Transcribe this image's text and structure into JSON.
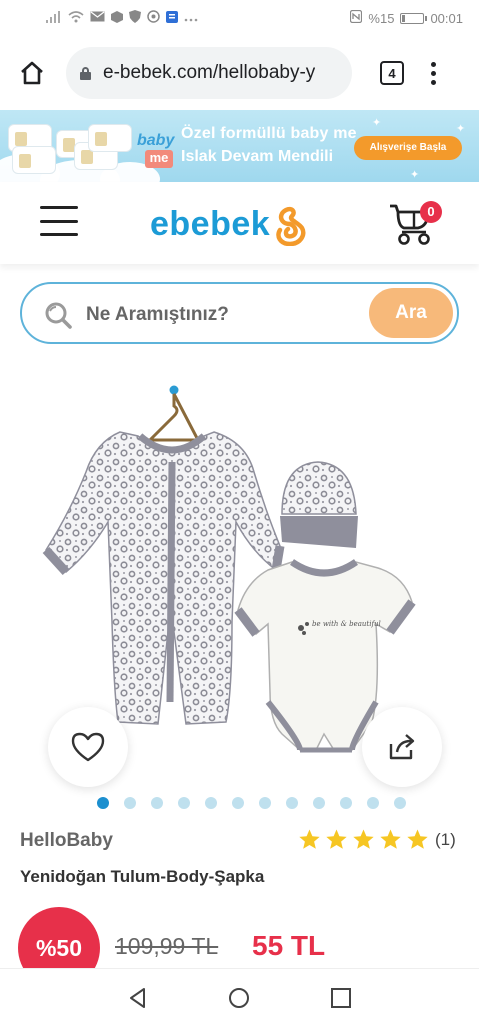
{
  "status_bar": {
    "battery": "%15",
    "battery_level": 0.15,
    "time": "00:01"
  },
  "browser": {
    "url": "e-bebek.com/hellobaby-y",
    "tab_count": "4"
  },
  "banner": {
    "line1": "Özel formüllü baby me",
    "line2": "Islak Devam Mendili",
    "cta": "Alışverişe Başla",
    "baby": "baby",
    "me": "me"
  },
  "header": {
    "logo": "ebebek",
    "cart_count": "0"
  },
  "search": {
    "placeholder": "Ne Aramıştınız?",
    "button": "Ara"
  },
  "product": {
    "brand": "HelloBaby",
    "title": "Yenidoğan Tulum-Body-Şapka",
    "rating_stars": 5,
    "rating_count": "(1)",
    "discount": "%50",
    "old_price": "109,99 TL",
    "new_price": "55 TL",
    "image_dots": 12,
    "active_dot": 0,
    "onesie_print": "be with & beautiful"
  },
  "colors": {
    "brand_blue": "#1c9bd6",
    "brand_orange": "#f39a2b",
    "sale_red": "#e7304a",
    "search_border": "#5eb3da",
    "search_button": "#f7b97a",
    "star": "#f6c623"
  },
  "icons": {
    "home": "home-icon",
    "lock": "lock-icon",
    "tabs": "tabs-icon",
    "menu": "more-vert-icon",
    "hamburger": "hamburger-icon",
    "cart": "stroller-cart-icon",
    "search": "search-icon",
    "favorite": "heart-icon",
    "share": "share-icon",
    "back": "triangle-back-icon",
    "navhome": "circle-home-icon",
    "recent": "square-recent-icon"
  }
}
